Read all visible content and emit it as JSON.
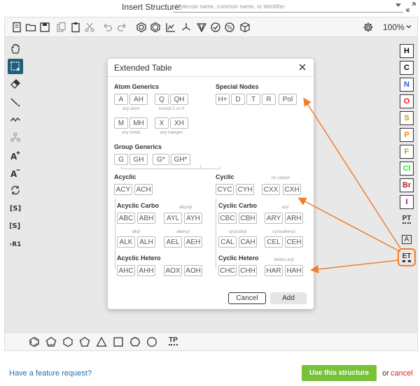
{
  "insert": {
    "label": "Insert Structure:",
    "placeholder": "Molecule name, common name, or identifier"
  },
  "toolbar": {
    "zoom": "100%"
  },
  "right_toolbar": {
    "atoms": [
      {
        "symbol": "H",
        "color": "#000000"
      },
      {
        "symbol": "C",
        "color": "#000000"
      },
      {
        "symbol": "N",
        "color": "#304ff7"
      },
      {
        "symbol": "O",
        "color": "#ff0d0d"
      },
      {
        "symbol": "S",
        "color": "#c99a00"
      },
      {
        "symbol": "P",
        "color": "#ff8000"
      },
      {
        "symbol": "F",
        "color": "#78c23a"
      },
      {
        "symbol": "Cl",
        "color": "#1ff01f"
      },
      {
        "symbol": "Br",
        "color": "#a62929"
      },
      {
        "symbol": "I",
        "color": "#940094"
      }
    ],
    "periodic_table": "PT",
    "any_atom": "A",
    "extended_table": "ET"
  },
  "bottom_toolbar": {
    "template_palette": "TP"
  },
  "dialog": {
    "title": "Extended Table",
    "atom_generics": {
      "title": "Atom Generics",
      "row1": [
        "A",
        "AH",
        "Q",
        "QH"
      ],
      "row1_captions": [
        "any atom",
        "except C or H"
      ],
      "row2": [
        "M",
        "MH",
        "X",
        "XH"
      ],
      "row2_captions": [
        "any metal",
        "any halogen"
      ]
    },
    "special_nodes": {
      "title": "Special Nodes",
      "items": [
        "H+",
        "D",
        "T",
        "R",
        "Pol"
      ]
    },
    "group_generics": {
      "title": "Group Generics",
      "items": [
        "G",
        "GH",
        "G*",
        "GH*"
      ]
    },
    "acyclic": {
      "title": "Acyclic",
      "items": [
        "ACY",
        "ACH"
      ]
    },
    "cyclic": {
      "title": "Cyclic",
      "items": [
        "CYC",
        "CYH",
        "CXX",
        "CXH"
      ],
      "caption": "no carbon"
    },
    "acyclic_carbo": {
      "title": "Acyclic Carbo",
      "row1": [
        "ABC",
        "ABH",
        "AYL",
        "AYH"
      ],
      "row1_caption": "alkynyl",
      "row2": [
        "ALK",
        "ALH",
        "AEL",
        "AEH"
      ],
      "row2_captions": [
        "alkyl",
        "alkenyl"
      ]
    },
    "cyclic_carbo": {
      "title": "Cyclic Carbo",
      "row1": [
        "CBC",
        "CBH",
        "ARY",
        "ARH"
      ],
      "row1_caption": "aryl",
      "row2": [
        "CAL",
        "CAH",
        "CEL",
        "CEH"
      ],
      "row2_captions": [
        "cycloalkyl",
        "cycloalkenyl"
      ]
    },
    "acyclic_hetero": {
      "title": "Acyclic Hetero",
      "items": [
        "AHC",
        "AHH",
        "AOX",
        "AOH"
      ]
    },
    "cyclic_hetero": {
      "title": "Cyclic Hetero",
      "items": [
        "CHC",
        "CHH",
        "HAR",
        "HAH"
      ],
      "caption": "hetero aryl"
    },
    "cancel_label": "Cancel",
    "add_label": "Add"
  },
  "footer": {
    "feature_request": "Have a feature request?",
    "use_structure": "Use this structure",
    "or_text": "or",
    "cancel_text": "cancel"
  },
  "colors": {
    "accent": "#f07f2c",
    "use_button": "#78c23a",
    "link": "#1e6fb6",
    "cancel": "#e02020"
  }
}
